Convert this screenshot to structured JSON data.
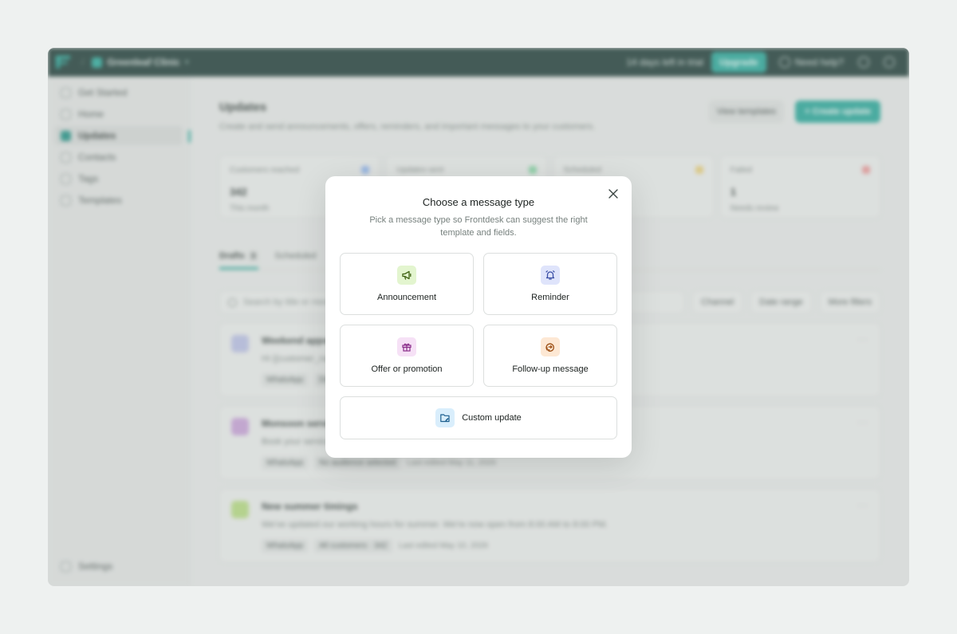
{
  "topbar": {
    "workspace": "Greenleaf Clinic",
    "trial_text": "14 days left in trial",
    "upgrade_label": "Upgrade",
    "help_label": "Need help?"
  },
  "sidebar": {
    "items": [
      {
        "label": "Get Started"
      },
      {
        "label": "Home"
      },
      {
        "label": "Updates"
      },
      {
        "label": "Contacts"
      },
      {
        "label": "Tags"
      },
      {
        "label": "Templates"
      }
    ],
    "settings_label": "Settings"
  },
  "page": {
    "title": "Updates",
    "subtitle": "Create and send announcements, offers, reminders, and important messages to your customers.",
    "view_templates_label": "View templates",
    "create_update_label": "+ Create update"
  },
  "stats": [
    {
      "label": "Customers reached",
      "value": "342",
      "sub": "This month",
      "color": "#3b82f6"
    },
    {
      "label": "Updates sent",
      "value": "",
      "sub": "",
      "color": "#22c55e"
    },
    {
      "label": "Scheduled",
      "value": "",
      "sub": "",
      "color": "#eab308"
    },
    {
      "label": "Failed",
      "value": "1",
      "sub": "Needs review",
      "color": "#ef4444"
    }
  ],
  "tabs": [
    {
      "label": "Drafts",
      "count": "3"
    },
    {
      "label": "Scheduled"
    }
  ],
  "filters": {
    "search_placeholder": "Search by title or message",
    "channel_label": "Channel",
    "date_label": "Date range",
    "more_label": "More filters"
  },
  "cards": [
    {
      "title": "Weekend appointments",
      "body": "Hi {{customer_name}}",
      "tags": [
        "WhatsApp",
        "Draft"
      ],
      "edited": "",
      "color": "#8b93e0"
    },
    {
      "title": "Monsoon service",
      "body": "Book your service",
      "tags": [
        "WhatsApp",
        "No audience selected"
      ],
      "edited": "Last edited May 11, 2026",
      "color": "#a855c7"
    },
    {
      "title": "New summer timings",
      "body": "We've updated our working hours for summer. We're now open from 8:00 AM to 8:00 PM.",
      "tags": [
        "WhatsApp",
        "All customers · 342"
      ],
      "edited": "Last edited May 10, 2026",
      "color": "#84cc16"
    }
  ],
  "modal": {
    "title": "Choose a message type",
    "subtitle": "Pick a message type so Frontdesk can suggest the right template and fields.",
    "options": [
      {
        "label": "Announcement",
        "icon": "megaphone-icon",
        "bg": "#e3f5cf",
        "fg": "#3f6212"
      },
      {
        "label": "Reminder",
        "icon": "bell-icon",
        "bg": "#dfe4fb",
        "fg": "#3b4fa6"
      },
      {
        "label": "Offer or promotion",
        "icon": "gift-icon",
        "bg": "#f6e1f6",
        "fg": "#8a2d8a"
      },
      {
        "label": "Follow-up message",
        "icon": "follow-up-icon",
        "bg": "#fde8d4",
        "fg": "#9a4b10"
      }
    ],
    "custom": {
      "label": "Custom update",
      "icon": "edit-folder-icon",
      "bg": "#d9eefc",
      "fg": "#1d5f8f"
    }
  }
}
